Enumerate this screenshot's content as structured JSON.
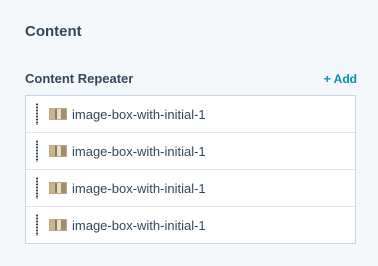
{
  "section": {
    "title": "Content"
  },
  "repeater": {
    "label": "Content Repeater",
    "add_label": "+ Add",
    "items": [
      {
        "label": "image-box-with-initial-1",
        "icon": "image-thumbnail-icon"
      },
      {
        "label": "image-box-with-initial-1",
        "icon": "image-thumbnail-icon"
      },
      {
        "label": "image-box-with-initial-1",
        "icon": "image-thumbnail-icon"
      },
      {
        "label": "image-box-with-initial-1",
        "icon": "image-thumbnail-icon"
      }
    ]
  },
  "colors": {
    "text": "#33475b",
    "accent": "#0091ae",
    "background": "#f5f8fa",
    "border": "#cbd6e2"
  }
}
